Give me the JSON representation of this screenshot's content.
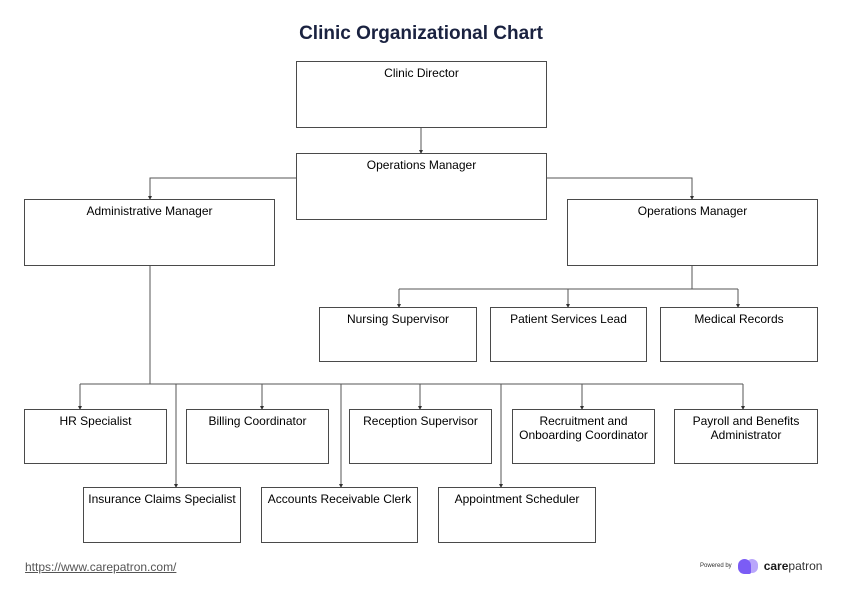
{
  "title": "Clinic Organizational Chart",
  "nodes": {
    "director": "Clinic Director",
    "ops_top": "Operations Manager",
    "admin": "Administrative Manager",
    "ops_right": "Operations Manager",
    "nursing": "Nursing Supervisor",
    "patient_services": "Patient Services Lead",
    "medical_records": "Medical Records",
    "hr": "HR Specialist",
    "billing": "Billing Coordinator",
    "reception": "Reception Supervisor",
    "recruitment": "Recruitment and Onboarding Coordinator",
    "payroll": "Payroll and Benefits Administrator",
    "insurance": "Insurance Claims Specialist",
    "accounts": "Accounts Receivable Clerk",
    "appointment": "Appointment Scheduler"
  },
  "footer": {
    "url": "https://www.carepatron.com/",
    "powered_by": "Powered by",
    "brand_bold": "care",
    "brand_rest": "patron"
  }
}
